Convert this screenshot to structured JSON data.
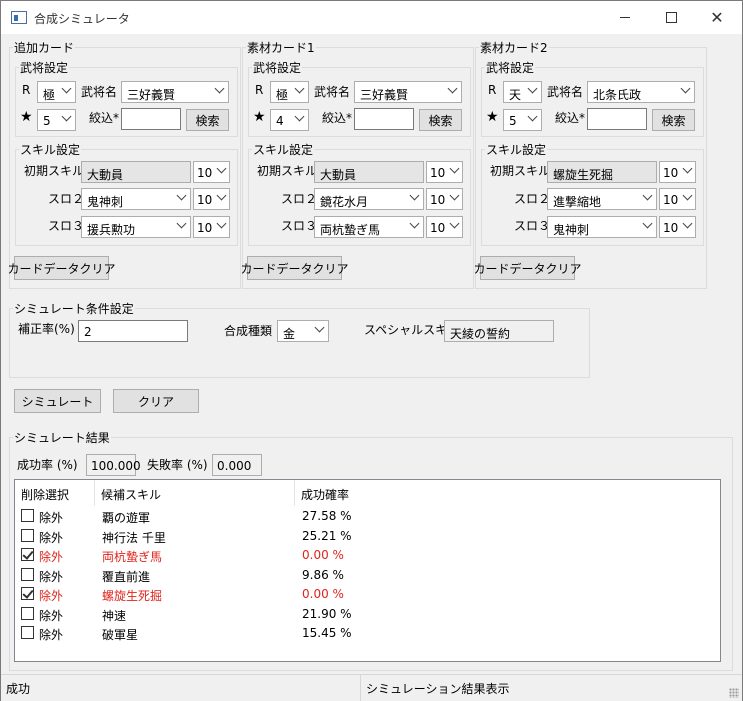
{
  "window": {
    "title": "合成シミュレータ"
  },
  "cards": [
    {
      "title": "追加カード",
      "busho_title": "武将設定",
      "r_label": "R",
      "r_value": "極",
      "name_label": "武将名",
      "name_value": "三好義賢",
      "star": "★",
      "star_value": "5",
      "filter_label": "絞込*",
      "filter_value": "",
      "search_label": "検索",
      "skill_title": "スキル設定",
      "initial_label": "初期スキル",
      "initial_value": "大動員",
      "initial_level": "10",
      "slot2_label": "スロ２",
      "slot2_value": "鬼神刺",
      "slot2_level": "10",
      "slot3_label": "スロ３",
      "slot3_value": "援兵勲功",
      "slot3_level": "10",
      "clear_label": "カードデータクリア"
    },
    {
      "title": "素材カード1",
      "busho_title": "武将設定",
      "r_label": "R",
      "r_value": "極",
      "name_label": "武将名",
      "name_value": "三好義賢",
      "star": "★",
      "star_value": "4",
      "filter_label": "絞込*",
      "filter_value": "",
      "search_label": "検索",
      "skill_title": "スキル設定",
      "initial_label": "初期スキル",
      "initial_value": "大動員",
      "initial_level": "10",
      "slot2_label": "スロ２",
      "slot2_value": "鏡花水月",
      "slot2_level": "10",
      "slot3_label": "スロ３",
      "slot3_value": "両杭蟄ぎ馬",
      "slot3_level": "10",
      "clear_label": "カードデータクリア"
    },
    {
      "title": "素材カード2",
      "busho_title": "武将設定",
      "r_label": "R",
      "r_value": "天",
      "name_label": "武将名",
      "name_value": "北条氏政",
      "star": "★",
      "star_value": "5",
      "filter_label": "絞込*",
      "filter_value": "",
      "search_label": "検索",
      "skill_title": "スキル設定",
      "initial_label": "初期スキル",
      "initial_value": "螺旋生死掘",
      "initial_level": "10",
      "slot2_label": "スロ２",
      "slot2_value": "進撃縮地",
      "slot2_level": "10",
      "slot3_label": "スロ３",
      "slot3_value": "鬼神刺",
      "slot3_level": "10",
      "clear_label": "カードデータクリア"
    }
  ],
  "sim_conditions": {
    "title": "シミュレート条件設定",
    "correction_label": "補正率(%)",
    "correction_value": "2",
    "type_label": "合成種類",
    "type_value": "金",
    "special_label": "スペシャルスキル",
    "special_value": "天綾の誓約"
  },
  "actions": {
    "simulate": "シミュレート",
    "clear": "クリア"
  },
  "results": {
    "title": "シミュレート結果",
    "success_label": "成功率 (%)",
    "success_value": "100.000",
    "failure_label": "失敗率 (%)",
    "failure_value": "0.000",
    "columns": [
      "削除選択",
      "候補スキル",
      "成功確率"
    ],
    "rows": [
      {
        "exclude": "除外",
        "skill": "覇の遊軍",
        "prob": "27.58 %",
        "checked": false
      },
      {
        "exclude": "除外",
        "skill": "神行法 千里",
        "prob": "25.21 %",
        "checked": false
      },
      {
        "exclude": "除外",
        "skill": "両杭蟄ぎ馬",
        "prob": "0.00 %",
        "checked": true
      },
      {
        "exclude": "除外",
        "skill": "覆直前進",
        "prob": "9.86 %",
        "checked": false
      },
      {
        "exclude": "除外",
        "skill": "螺旋生死掘",
        "prob": "0.00 %",
        "checked": true
      },
      {
        "exclude": "除外",
        "skill": "神速",
        "prob": "21.90 %",
        "checked": false
      },
      {
        "exclude": "除外",
        "skill": "破軍星",
        "prob": "15.45 %",
        "checked": false
      }
    ]
  },
  "statusbar": {
    "left": "成功",
    "right": "シミュレーション結果表示"
  }
}
